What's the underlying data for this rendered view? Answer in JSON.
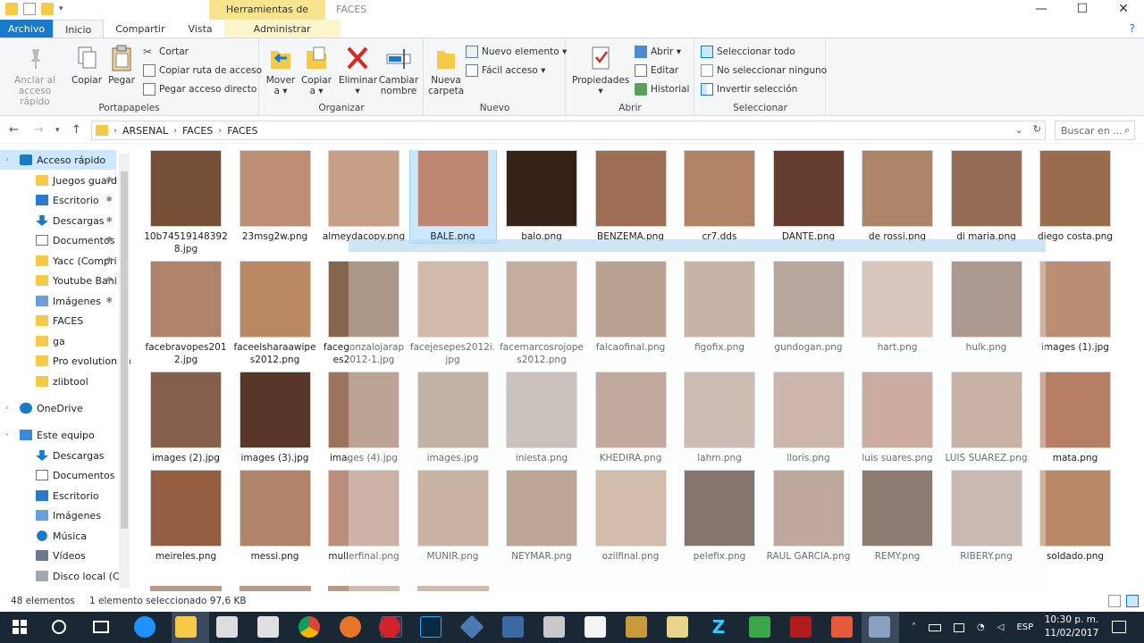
{
  "window": {
    "context_tab_title": "Herramientas de imagen",
    "title": "FACES",
    "minimize": "—",
    "maximize": "☐",
    "close": "✕"
  },
  "ribbon_tabs": {
    "file": "Archivo",
    "home": "Inicio",
    "share": "Compartir",
    "view": "Vista",
    "manage": "Administrar"
  },
  "ribbon": {
    "clipboard": {
      "label": "Portapapeles",
      "pin": "Anclar al acceso rápido",
      "copy": "Copiar",
      "paste": "Pegar",
      "cut": "Cortar",
      "copy_path": "Copiar ruta de acceso",
      "paste_shortcut": "Pegar acceso directo"
    },
    "organize": {
      "label": "Organizar",
      "move": "Mover a ▾",
      "copy_to": "Copiar a ▾",
      "delete": "Eliminar ▾",
      "rename": "Cambiar nombre"
    },
    "new": {
      "label": "Nuevo",
      "new_folder": "Nueva carpeta",
      "new_item": "Nuevo elemento ▾",
      "easy_access": "Fácil acceso ▾"
    },
    "open": {
      "label": "Abrir",
      "properties": "Propiedades ▾",
      "open": "Abrir ▾",
      "edit": "Editar",
      "history": "Historial"
    },
    "select": {
      "label": "Seleccionar",
      "select_all": "Seleccionar todo",
      "select_none": "No seleccionar ninguno",
      "invert": "Invertir selección"
    }
  },
  "address": {
    "crumbs": [
      "ARSENAL",
      "FACES",
      "FACES"
    ],
    "search_placeholder": "Buscar en ..."
  },
  "nav": [
    {
      "label": "Acceso rápido",
      "type": "star",
      "pinned": false,
      "selected": true
    },
    {
      "label": "Juegos guard",
      "type": "folder",
      "pinned": true
    },
    {
      "label": "Escritorio",
      "type": "desktop",
      "pinned": true
    },
    {
      "label": "Descargas",
      "type": "download",
      "pinned": true
    },
    {
      "label": "Documentos",
      "type": "docs",
      "pinned": true
    },
    {
      "label": "Yacc (Compri",
      "type": "folder",
      "pinned": true
    },
    {
      "label": "Youtube Bani",
      "type": "folder",
      "pinned": true
    },
    {
      "label": "Imágenes",
      "type": "pictures",
      "pinned": true
    },
    {
      "label": "FACES",
      "type": "folder",
      "pinned": false
    },
    {
      "label": "ga",
      "type": "folder",
      "pinned": false
    },
    {
      "label": "Pro evolution so",
      "type": "folder",
      "pinned": false
    },
    {
      "label": "zlibtool",
      "type": "folder",
      "pinned": false
    },
    {
      "label": "OneDrive",
      "type": "cloud",
      "pinned": false
    },
    {
      "label": "Este equipo",
      "type": "pc",
      "pinned": false
    },
    {
      "label": "Descargas",
      "type": "download",
      "pinned": false
    },
    {
      "label": "Documentos",
      "type": "docs",
      "pinned": false
    },
    {
      "label": "Escritorio",
      "type": "desktop",
      "pinned": false
    },
    {
      "label": "Imágenes",
      "type": "pictures",
      "pinned": false
    },
    {
      "label": "Música",
      "type": "music",
      "pinned": false
    },
    {
      "label": "Vídeos",
      "type": "video",
      "pinned": false
    },
    {
      "label": "Disco local (C:)",
      "type": "drive",
      "pinned": false
    }
  ],
  "files": [
    {
      "name": "10b745191483928.jpg",
      "tone": "#7a5238"
    },
    {
      "name": "23msg2w.png",
      "tone": "#c8967a"
    },
    {
      "name": "almeydacopy.png",
      "tone": "#d2a88e"
    },
    {
      "name": "BALE.png",
      "tone": "#c88e78",
      "selected": true
    },
    {
      "name": "balo.png",
      "tone": "#3a2418"
    },
    {
      "name": "BENZEMA.png",
      "tone": "#a57458"
    },
    {
      "name": "cr7.dds",
      "tone": "#b98a6c"
    },
    {
      "name": "DANTE.png",
      "tone": "#6a4030"
    },
    {
      "name": "de rossi.png",
      "tone": "#b58c6e"
    },
    {
      "name": "di maria.png",
      "tone": "#9c7258"
    },
    {
      "name": "diego costa.png",
      "tone": "#a27252"
    },
    {
      "name": "facebravopes2012.jpg",
      "tone": "#b88a70"
    },
    {
      "name": "faceelsharaawipes2012.png",
      "tone": "#c49068"
    },
    {
      "name": "facegonzalojarapes2012-1.jpg",
      "tone": "#8c6a50"
    },
    {
      "name": "facejesepes2012i.jpg",
      "tone": "#c8a08a"
    },
    {
      "name": "facemarcosrojopes2012.png",
      "tone": "#b48a72"
    },
    {
      "name": "falcaofinal.png",
      "tone": "#a07a62"
    },
    {
      "name": "figofix.png",
      "tone": "#b89682"
    },
    {
      "name": "gundogan.png",
      "tone": "#9c8070"
    },
    {
      "name": "hart.png",
      "tone": "#d4b4a4"
    },
    {
      "name": "hulk.png",
      "tone": "#8a6a5a"
    },
    {
      "name": "images (1).jpg",
      "tone": "#c4967a"
    },
    {
      "name": "images (2).jpg",
      "tone": "#8c6450"
    },
    {
      "name": "images (3).jpg",
      "tone": "#5a3a2a"
    },
    {
      "name": "images (4).jpg",
      "tone": "#a47a62"
    },
    {
      "name": "images.jpg",
      "tone": "#b0927e"
    },
    {
      "name": "iniesta.png",
      "tone": "#b8aca4"
    },
    {
      "name": "KHEDIRA.png",
      "tone": "#b08672"
    },
    {
      "name": "lahm.png",
      "tone": "#c0a494"
    },
    {
      "name": "lloris.png",
      "tone": "#c09a8a"
    },
    {
      "name": "luis suares.png",
      "tone": "#c08a76"
    },
    {
      "name": "LUIS SUAREZ.png",
      "tone": "#b89480"
    },
    {
      "name": "mata.png",
      "tone": "#c0866a"
    },
    {
      "name": "meireles.png",
      "tone": "#9c6244"
    },
    {
      "name": "messi.png",
      "tone": "#b88a70"
    },
    {
      "name": "mullerfinal.png",
      "tone": "#c49482"
    },
    {
      "name": "MUNIR.png",
      "tone": "#b8967e"
    },
    {
      "name": "NEYMAR.png",
      "tone": "#a88068"
    },
    {
      "name": "ozilfinal.png",
      "tone": "#c8a48c"
    },
    {
      "name": "pelefix.png",
      "tone": "#4a3428"
    },
    {
      "name": "RAUL GARCIA.png",
      "tone": "#a88270"
    },
    {
      "name": "REMY.png",
      "tone": "#5a3c2e"
    },
    {
      "name": "RIBERY.png",
      "tone": "#b8a096"
    },
    {
      "name": "soldado.png",
      "tone": "#c49070"
    }
  ],
  "status": {
    "count": "48 elementos",
    "selection": "1 elemento seleccionado  97,6 KB"
  },
  "taskbar": {
    "lang": "ESP",
    "time": "10:30 p. m.",
    "date": "11/02/2017"
  },
  "colors": {
    "accent": "#1979ca",
    "ctx_tab": "#f6e58d",
    "taskbar": "#1a2836"
  }
}
